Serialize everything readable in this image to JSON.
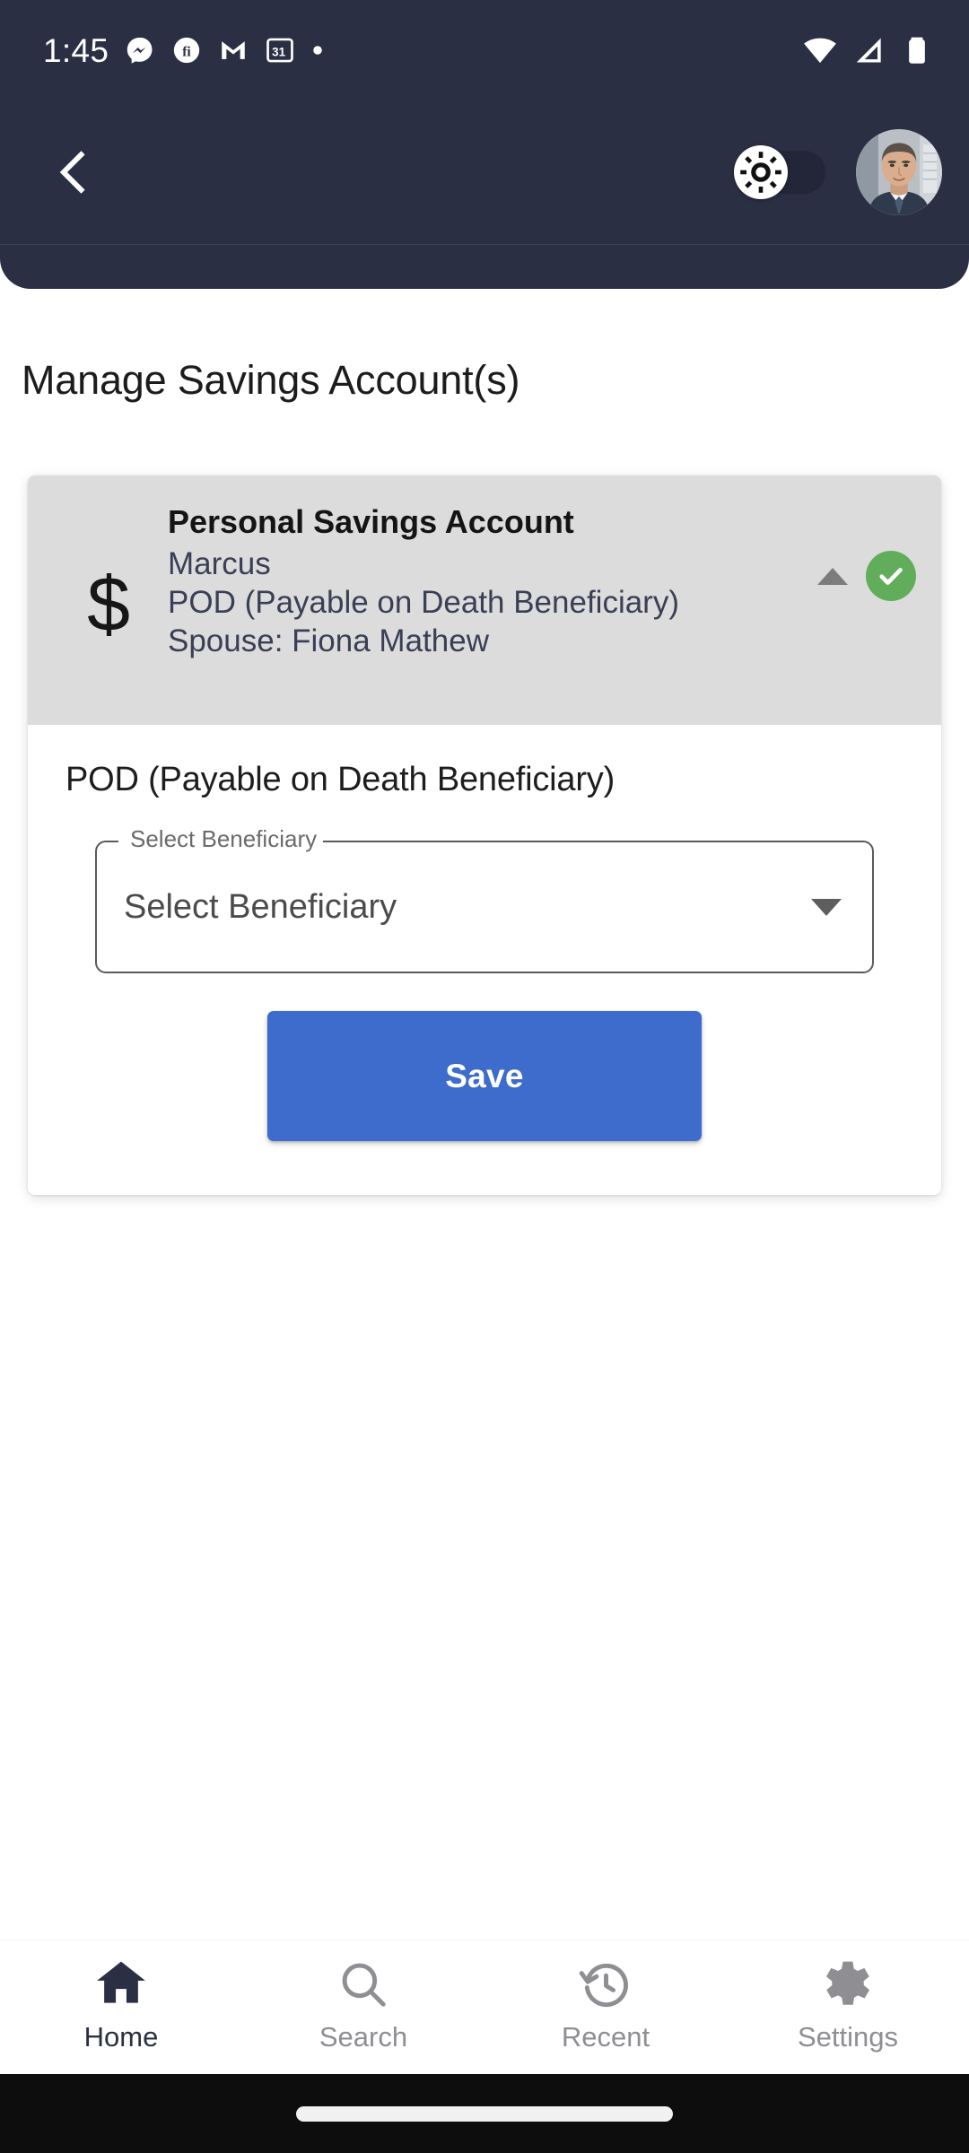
{
  "status_bar": {
    "time": "1:45",
    "left_icons": [
      "messenger-icon",
      "fi-circle-icon",
      "mail-icon",
      "calendar-31-icon",
      "dot-icon"
    ],
    "calendar_day": "31",
    "right_icons": [
      "wifi-icon",
      "cellular-signal-icon",
      "battery-icon"
    ]
  },
  "app_bar": {
    "back_icon": "back-chevron-icon",
    "theme_toggle": {
      "icon": "sun-icon",
      "state": "light",
      "track_color": "#232638"
    },
    "avatar": "user-avatar"
  },
  "page": {
    "title": "Manage Savings Account(s)"
  },
  "account_card": {
    "icon": "$",
    "title": "Personal Savings Account",
    "lines": [
      "Marcus",
      "POD (Payable on Death Beneficiary)",
      "Spouse: Fiona Mathew"
    ],
    "collapse_icon": "caret-up-icon",
    "status_icon": "check-circle-icon",
    "status_color": "#61ad5b",
    "header_bg": "#dcdcdc"
  },
  "panel": {
    "section_title": "POD (Payable on Death Beneficiary)",
    "beneficiary_field": {
      "label": "Select Beneficiary",
      "value": "Select Beneficiary",
      "placeholder": "Select Beneficiary",
      "dropdown_icon": "caret-down-icon"
    },
    "save_label": "Save",
    "save_color": "#3e6ccc"
  },
  "bottom_nav": {
    "items": [
      {
        "label": "Home",
        "icon": "home-icon",
        "active": true
      },
      {
        "label": "Search",
        "icon": "search-icon",
        "active": false
      },
      {
        "label": "Recent",
        "icon": "history-icon",
        "active": false
      },
      {
        "label": "Settings",
        "icon": "gear-icon",
        "active": false
      }
    ],
    "active_color": "#2b2f44",
    "inactive_color": "#8e8e93"
  }
}
